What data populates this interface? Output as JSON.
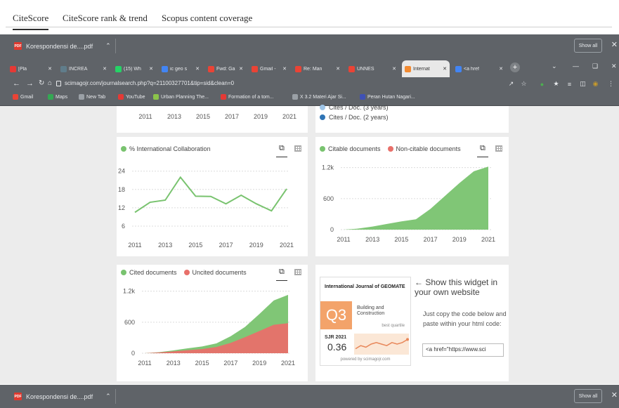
{
  "scopus_tabs": [
    "CiteScore",
    "CiteScore rank & trend",
    "Scopus content coverage"
  ],
  "downloads": {
    "file": "Korespondensi de....pdf",
    "show_all": "Show all"
  },
  "browser": {
    "tabs": [
      {
        "label": "[Pla",
        "active": false,
        "icon": "youtube-icon",
        "color": "#e53935"
      },
      {
        "label": "INCREA",
        "active": false,
        "icon": "doc-icon",
        "color": "#607d8b"
      },
      {
        "label": "(15) Wh",
        "active": false,
        "icon": "whatsapp-icon",
        "color": "#25d366"
      },
      {
        "label": "ic geo s",
        "active": false,
        "icon": "google-icon",
        "color": "#4285f4"
      },
      {
        "label": "Fwd: Gal",
        "active": false,
        "icon": "gmail-icon",
        "color": "#ea4335"
      },
      {
        "label": "Gmail - ",
        "active": false,
        "icon": "gmail-icon",
        "color": "#ea4335"
      },
      {
        "label": "Re: Man",
        "active": false,
        "icon": "gmail-icon",
        "color": "#ea4335"
      },
      {
        "label": "UNNES",
        "active": false,
        "icon": "gmail-icon",
        "color": "#ea4335"
      },
      {
        "label": "Internat",
        "active": true,
        "icon": "sjr-icon",
        "color": "#f28a31"
      },
      {
        "label": "<a href",
        "active": false,
        "icon": "google-icon",
        "color": "#4285f4"
      }
    ],
    "url": "scimagojr.com/journalsearch.php?q=21100327701&tip=sid&clean=0",
    "bookmarks": [
      {
        "label": "Gmail",
        "color": "#ea4335"
      },
      {
        "label": "Maps",
        "color": "#34a853"
      },
      {
        "label": "New Tab",
        "color": "#9aa0a6"
      },
      {
        "label": "YouTube",
        "color": "#e53935"
      },
      {
        "label": "Urban Planning The...",
        "color": "#8bc34a"
      },
      {
        "label": "Formation of a tom...",
        "color": "#e53935"
      },
      {
        "label": "X 3.2 Materi Ajar Si...",
        "color": "#9aa0a6"
      },
      {
        "label": "Peran Hutan Nagari...",
        "color": "#3f51b5"
      }
    ]
  },
  "top_card": {
    "x_labels": [
      "2011",
      "2013",
      "2015",
      "2017",
      "2019",
      "2021"
    ],
    "legend": [
      "Cites / Doc. (3 years)",
      "Cites / Doc. (2 years)"
    ]
  },
  "chart_data": [
    {
      "type": "line",
      "title": "% International Collaboration",
      "series": [
        {
          "name": "% International Collaboration",
          "color": "#79c36f",
          "x": [
            2011,
            2012,
            2013,
            2014,
            2015,
            2016,
            2017,
            2018,
            2019,
            2020,
            2021
          ],
          "values": [
            10.5,
            13.8,
            14.5,
            22.0,
            15.8,
            15.7,
            13.3,
            16.1,
            13.3,
            11.0,
            18.2
          ]
        }
      ],
      "x_tick_labels": [
        "2011",
        "2013",
        "2015",
        "2017",
        "2019",
        "2021"
      ],
      "y_tick_labels": [
        "24",
        "18",
        "12",
        "6"
      ],
      "ylim": [
        3,
        26
      ]
    },
    {
      "type": "area",
      "title": "Citable documents / Non-citable documents",
      "series": [
        {
          "name": "Citable documents",
          "color": "#79c36f",
          "x": [
            2011,
            2012,
            2013,
            2014,
            2015,
            2016,
            2017,
            2018,
            2019,
            2020,
            2021
          ],
          "values": [
            0,
            20,
            60,
            110,
            160,
            200,
            400,
            650,
            900,
            1130,
            1220
          ]
        },
        {
          "name": "Non-citable documents",
          "color": "#e8706a",
          "x": [
            2011,
            2012,
            2013,
            2014,
            2015,
            2016,
            2017,
            2018,
            2019,
            2020,
            2021
          ],
          "values": [
            0,
            0,
            0,
            0,
            0,
            0,
            0,
            0,
            0,
            0,
            0
          ]
        }
      ],
      "x_tick_labels": [
        "2011",
        "2013",
        "2015",
        "2017",
        "2019",
        "2021"
      ],
      "y_tick_labels": [
        "1.2k",
        "600",
        "0"
      ],
      "ylim": [
        0,
        1250
      ]
    },
    {
      "type": "area",
      "title": "Cited documents / Uncited documents",
      "series": [
        {
          "name": "Uncited documents",
          "color": "#e8706a",
          "x": [
            2011,
            2012,
            2013,
            2014,
            2015,
            2016,
            2017,
            2018,
            2019,
            2020,
            2021
          ],
          "values": [
            0,
            15,
            35,
            60,
            80,
            120,
            200,
            310,
            430,
            550,
            580
          ]
        },
        {
          "name": "Cited documents",
          "color": "#79c36f",
          "x": [
            2011,
            2012,
            2013,
            2014,
            2015,
            2016,
            2017,
            2018,
            2019,
            2020,
            2021
          ],
          "values": [
            0,
            20,
            55,
            95,
            130,
            190,
            330,
            510,
            760,
            1020,
            1130
          ]
        }
      ],
      "x_tick_labels": [
        "2011",
        "2013",
        "2015",
        "2017",
        "2019",
        "2021"
      ],
      "y_tick_labels": [
        "1.2k",
        "600",
        "0"
      ],
      "ylim": [
        0,
        1250
      ]
    }
  ],
  "widget": {
    "journal": "International Journal of GEOMATE",
    "quartile": "Q3",
    "category": "Building and Construction",
    "best_quartile": "best quartile",
    "sjr_label": "SJR 2021",
    "sjr_value": "0.36",
    "powered": "powered by scimagojr.com",
    "sparkline": [
      0.3,
      0.32,
      0.31,
      0.33,
      0.34,
      0.33,
      0.32,
      0.34,
      0.33,
      0.34,
      0.36
    ]
  },
  "widget_info": {
    "headline": "← Show this widget in your own website",
    "body": "Just copy the code below and paste within your html code:",
    "code": "<a href=\"https://www.sci"
  }
}
